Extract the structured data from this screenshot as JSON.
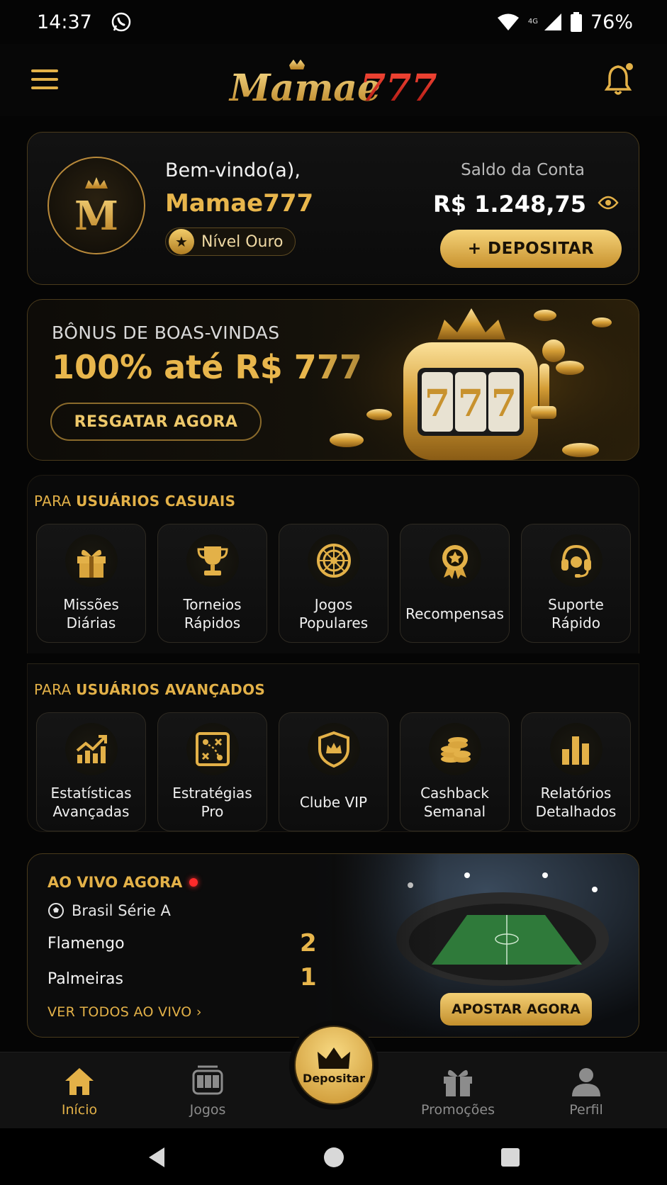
{
  "status_bar": {
    "time": "14:37",
    "network": "4G",
    "battery": "76%"
  },
  "header": {
    "logo_text_a": "Mamae",
    "logo_text_b": "777",
    "notification_dot": true
  },
  "welcome": {
    "greeting": "Bem-vindo(a),",
    "username": "Mamae777",
    "avatar_letter": "M",
    "level": "Nível Ouro",
    "balance_label": "Saldo da Conta",
    "balance_value": "R$ 1.248,75",
    "deposit_label": "+ DEPOSITAR"
  },
  "bonus": {
    "subtitle": "BÔNUS DE BOAS-VINDAS",
    "headline": "100% até R$ 777",
    "cta": "RESGATAR AGORA",
    "slot_digits": "777"
  },
  "casual": {
    "title_a": "PARA",
    "title_b": "USUÁRIOS CASUAIS",
    "items": [
      {
        "label": "Missões\nDiárias",
        "icon": "gift-icon"
      },
      {
        "label": "Torneios\nRápidos",
        "icon": "trophy-icon"
      },
      {
        "label": "Jogos\nPopulares",
        "icon": "roulette-icon"
      },
      {
        "label": "Recompensas",
        "icon": "medal-icon"
      },
      {
        "label": "Suporte\nRápido",
        "icon": "headset-icon"
      }
    ]
  },
  "advanced": {
    "title_a": "PARA",
    "title_b": "USUÁRIOS AVANÇADOS",
    "items": [
      {
        "label": "Estatísticas\nAvançadas",
        "icon": "trend-chart-icon"
      },
      {
        "label": "Estratégias\nPro",
        "icon": "strategy-board-icon"
      },
      {
        "label": "Clube VIP",
        "icon": "vip-shield-icon"
      },
      {
        "label": "Cashback\nSemanal",
        "icon": "coin-stack-icon"
      },
      {
        "label": "Relatórios\nDetalhados",
        "icon": "bar-chart-icon"
      }
    ]
  },
  "live": {
    "title": "AO VIVO AGORA",
    "league": "Brasil Série A",
    "teams": [
      {
        "name": "Flamengo",
        "score": "2"
      },
      {
        "name": "Palmeiras",
        "score": "1"
      }
    ],
    "see_all": "VER TODOS AO VIVO",
    "bet_cta": "APOSTAR AGORA"
  },
  "bottom_nav": {
    "items": [
      {
        "label": "Início",
        "icon": "home-icon",
        "active": true
      },
      {
        "label": "Jogos",
        "icon": "slot-machine-icon",
        "active": false
      },
      {
        "label": "Promoções",
        "icon": "gift-icon",
        "active": false
      },
      {
        "label": "Perfil",
        "icon": "user-icon",
        "active": false
      }
    ],
    "center_label": "Depositar"
  },
  "colors": {
    "gold": "#e6b54a",
    "background": "#050505",
    "live_dot": "#ff2b2b"
  }
}
